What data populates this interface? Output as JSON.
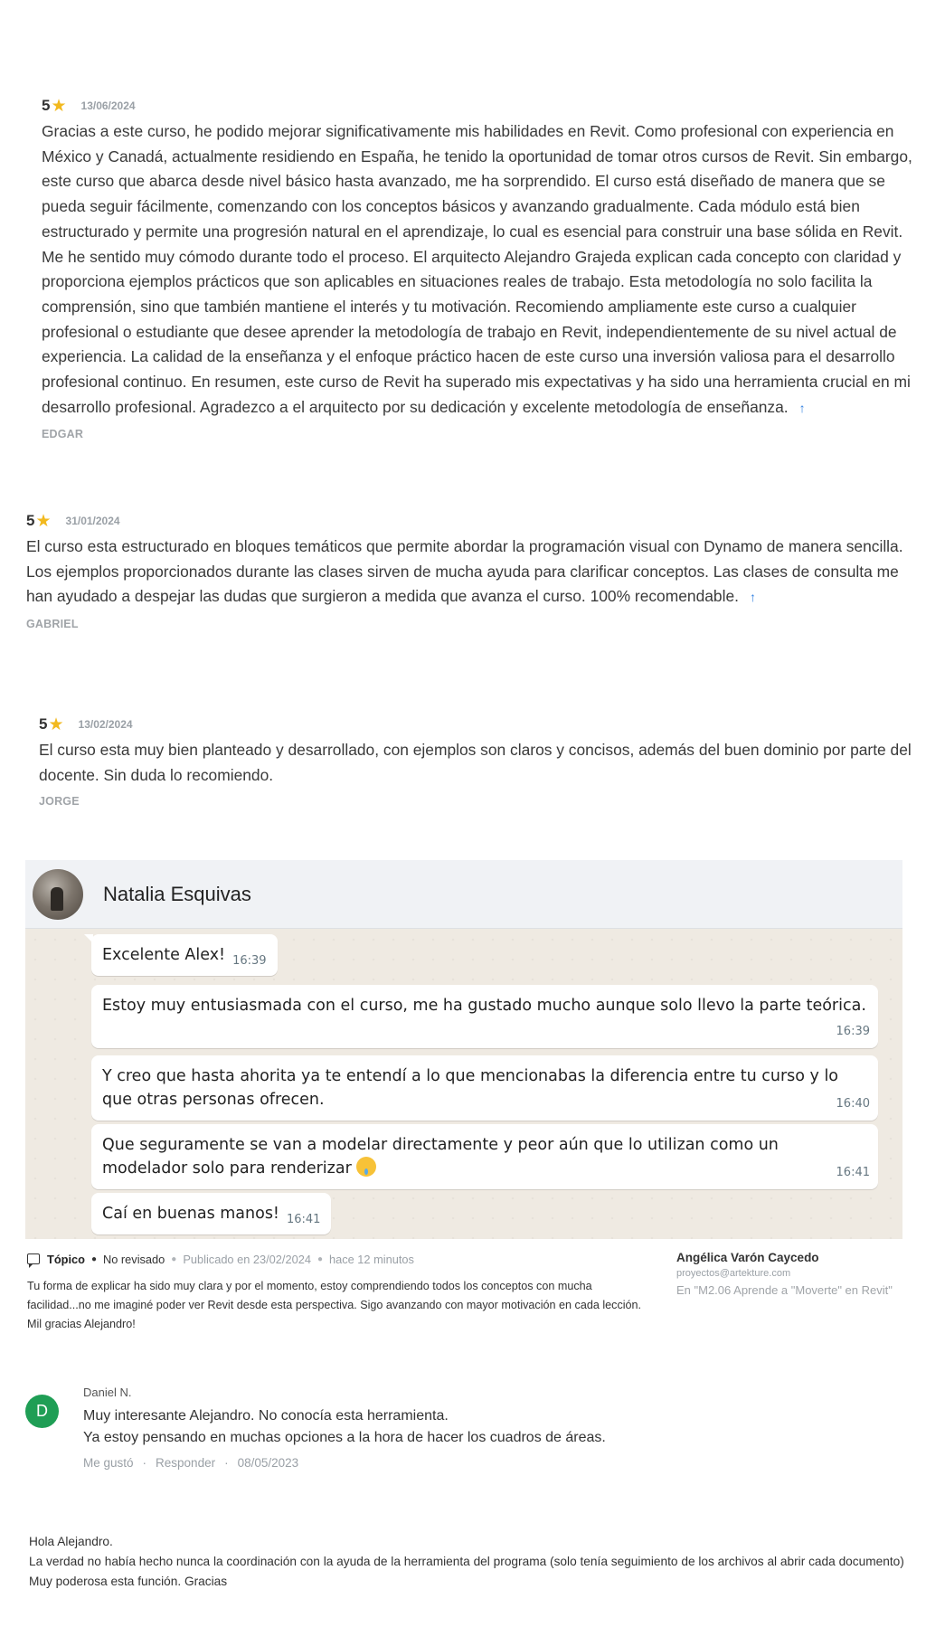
{
  "reviews": [
    {
      "score": "5",
      "date": "13/06/2024",
      "text": "Gracias a este curso, he podido mejorar significativamente mis habilidades en Revit. Como profesional con experiencia en México y Canadá, actualmente residiendo en España, he tenido la oportunidad de tomar otros cursos de Revit. Sin embargo, este curso que abarca desde nivel básico hasta avanzado, me ha sorprendido. El curso está diseñado de manera que se pueda seguir fácilmente, comenzando con los conceptos básicos y avanzando gradualmente. Cada módulo está bien estructurado y permite una progresión natural en el aprendizaje, lo cual es esencial para construir una base sólida en Revit. Me he sentido muy cómodo durante todo el proceso. El arquitecto Alejandro Grajeda explican cada concepto con claridad y proporciona ejemplos prácticos que son aplicables en situaciones reales de trabajo. Esta metodología no solo facilita la comprensión, sino que también mantiene el interés y tu motivación. Recomiendo ampliamente este curso a cualquier profesional o estudiante que desee aprender la metodología de trabajo en Revit, independientemente de su nivel actual de experiencia. La calidad de la enseñanza y el enfoque práctico hacen de este curso una inversión valiosa para el desarrollo profesional continuo. En resumen, este curso de Revit ha superado mis expectativas y ha sido una herramienta crucial en mi desarrollo profesional. Agradezco a el arquitecto por su dedicación y excelente metodología de enseñanza.",
      "author": "EDGAR"
    },
    {
      "score": "5",
      "date": "31/01/2024",
      "text": "El curso esta estructurado en bloques temáticos que permite abordar la programación visual con Dynamo de manera sencilla. Los ejemplos proporcionados durante las clases sirven de mucha ayuda para clarificar conceptos. Las clases de consulta me han ayudado a despejar las dudas que surgieron a medida que avanza el curso. 100% recomendable.",
      "author": "GABRIEL"
    },
    {
      "score": "5",
      "date": "13/02/2024",
      "text": "El curso esta muy bien planteado y desarrollado, con ejemplos son claros y concisos, además del buen dominio por parte del docente. Sin duda lo recomiendo.",
      "author": "JORGE"
    }
  ],
  "icons": {
    "star": "★",
    "up_arrow": "↑"
  },
  "colors": {
    "star": "#f2b91f",
    "arrow": "#2f7fe0",
    "chat_bg": "#efeae2",
    "avatar_green": "#1f9e55"
  },
  "chat": {
    "contact_name": "Natalia Esquivas",
    "messages": [
      {
        "text": "Excelente Alex!",
        "time": "16:39"
      },
      {
        "text": "Estoy muy entusiasmada con el curso, me ha gustado mucho aunque solo llevo la parte teórica.",
        "time": "16:39"
      },
      {
        "text": "Y creo que hasta ahorita ya te entendí a lo que mencionabas la diferencia entre tu curso y lo que otras personas ofrecen.",
        "time": "16:40"
      },
      {
        "text": "Que seguramente se van a modelar directamente y peor aún que lo utilizan como un modelador solo para renderizar",
        "time": "16:41"
      },
      {
        "text": "Caí en buenas manos!",
        "time": "16:41"
      }
    ]
  },
  "topic": {
    "label": "Tópico",
    "status": "No revisado",
    "published": "Publicado en 23/02/2024",
    "ago": "hace 12 minutos",
    "body": "Tu forma de explicar ha sido muy clara y por el momento, estoy comprendiendo todos los conceptos con mucha facilidad...no me imaginé poder ver Revit desde esta perspectiva. Sigo avanzando con mayor motivación en cada lección. Mil gracias Alejandro!",
    "author": "Angélica Varón Caycedo",
    "email": "proyectos@artekture.com",
    "in_lesson": "En \"M2.06 Aprende a \"Moverte\" en Revit\""
  },
  "comment": {
    "avatar_letter": "D",
    "user": "Daniel N.",
    "line1": "Muy interesante Alejandro. No conocía esta herramienta.",
    "line2": "Ya estoy pensando en muchas opciones a la hora de hacer los cuadros de áreas.",
    "like": "Me gustó",
    "reply": "Responder",
    "separator": "·",
    "date": "08/05/2023"
  },
  "note": {
    "line1": "Hola Alejandro.",
    "line2": "La verdad no había hecho nunca la coordinación con la ayuda de la herramienta del programa (solo tenía seguimiento de los archivos al abrir cada documento)",
    "line3": "Muy poderosa esta función. Gracias"
  }
}
